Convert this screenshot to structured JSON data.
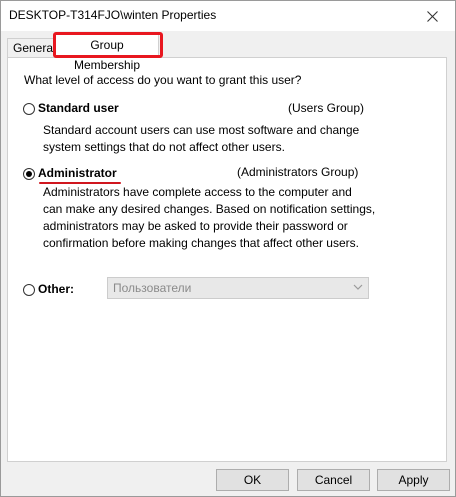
{
  "window": {
    "title": "DESKTOP-T314FJO\\winten Properties",
    "close_icon": "close-icon"
  },
  "tabs": [
    {
      "label": "General"
    },
    {
      "label": "Group Membership",
      "selected": true
    }
  ],
  "panel": {
    "question": "What level of access do you want to grant this user?",
    "options": [
      {
        "label": "Standard user",
        "group": "(Users Group)",
        "description_lines": [
          "Standard account users can use most software and change",
          "system settings that do not affect other users."
        ],
        "checked": false
      },
      {
        "label": "Administrator",
        "group": "(Administrators Group)",
        "description_lines": [
          "Administrators have complete access to the computer and",
          "can make any desired changes. Based on notification settings,",
          "administrators may be asked to provide their password or",
          "confirmation before making changes that affect other users."
        ],
        "checked": true
      },
      {
        "label": "Other:",
        "select_value": "Пользователи",
        "checked": false
      }
    ]
  },
  "buttons": {
    "ok": "OK",
    "cancel": "Cancel",
    "apply": "Apply"
  },
  "colors": {
    "highlight": "#e8171f",
    "window_bg": "#f0f0f0",
    "panel_bg": "#ffffff"
  }
}
